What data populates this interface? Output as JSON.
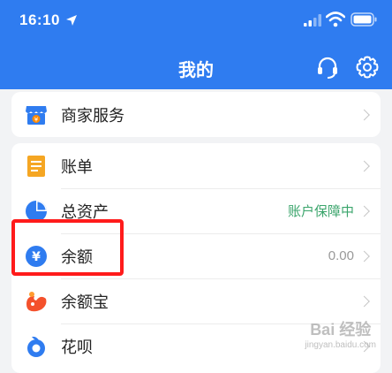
{
  "status_bar": {
    "time": "16:10"
  },
  "header": {
    "title": "我的"
  },
  "merchant_card": {
    "items": [
      {
        "label": "商家服务",
        "icon": "shop-icon"
      }
    ]
  },
  "main_list": {
    "items": [
      {
        "label": "账单",
        "icon": "bill-icon",
        "value": ""
      },
      {
        "label": "总资产",
        "icon": "pie-chart-icon",
        "value": "账户保障中"
      },
      {
        "label": "余额",
        "icon": "yuan-icon",
        "value": "0.00"
      },
      {
        "label": "余额宝",
        "icon": "yuebao-icon",
        "value": ""
      },
      {
        "label": "花呗",
        "icon": "huabei-icon",
        "value": ""
      }
    ]
  },
  "watermark": {
    "main": "Bai 经验",
    "sub": "jingyan.baidu.com"
  },
  "colors": {
    "header_bg": "#2f7cf0",
    "highlight": "#ff1b1b",
    "green_status": "#3ba56c"
  }
}
